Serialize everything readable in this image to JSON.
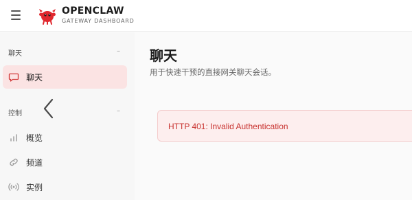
{
  "header": {
    "brand_name": "OPENCLAW",
    "brand_subtitle": "GATEWAY DASHBOARD",
    "menu_icon": "hamburger-icon",
    "logo_icon": "openclaw-crab-logo",
    "accent_color": "#e0282e"
  },
  "sidebar": {
    "sections": [
      {
        "title": "聊天",
        "collapse_symbol": "–",
        "items": [
          {
            "label": "聊天",
            "icon": "chat-bubble-icon",
            "active": true
          }
        ]
      },
      {
        "title": "控制",
        "collapse_symbol": "–",
        "items": [
          {
            "label": "概览",
            "icon": "bar-chart-icon",
            "active": false
          },
          {
            "label": "频道",
            "icon": "link-icon",
            "active": false
          },
          {
            "label": "实例",
            "icon": "broadcast-icon",
            "active": false
          }
        ]
      }
    ],
    "collapse_icon": "chevron-left-icon"
  },
  "main": {
    "title": "聊天",
    "subtitle": "用于快速干预的直接网关聊天会话。",
    "error": {
      "message": "HTTP 401: Invalid Authentication",
      "color": "#c8322f"
    }
  }
}
